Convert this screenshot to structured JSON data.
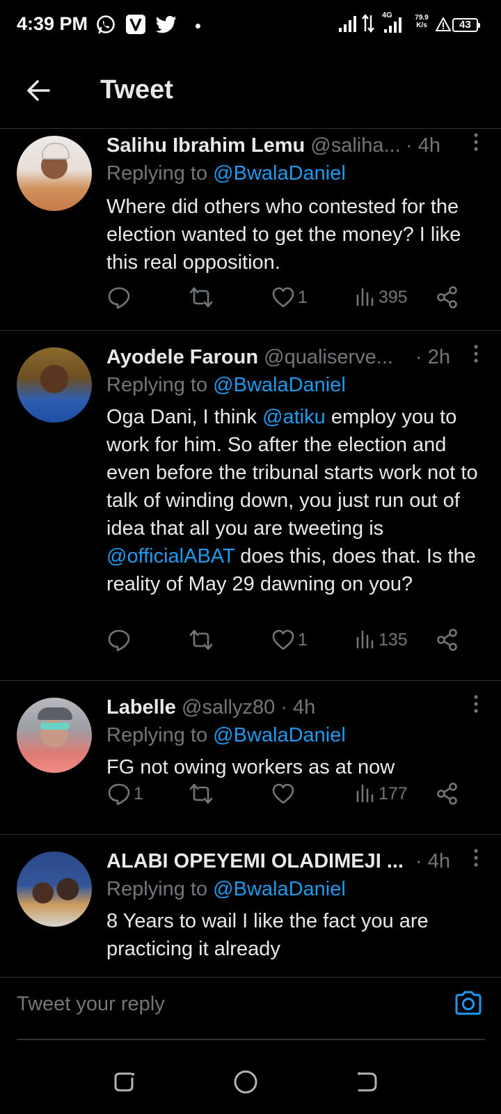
{
  "status_bar": {
    "time": "4:39 PM",
    "app_icons": [
      "whatsapp-icon",
      "vpn-v-icon",
      "twitter-icon"
    ],
    "network": "4G",
    "speed_value": "79.9",
    "speed_unit": "K/s",
    "battery": "43"
  },
  "header": {
    "title": "Tweet",
    "back_icon": "arrow-left-icon"
  },
  "replies": [
    {
      "name": "Salihu Ibrahim Lemu",
      "handle": "@saliha...",
      "time": "· 4h",
      "replying_prefix": "Replying to ",
      "replying_to": "@BwalaDaniel",
      "text": "Where did others who contested for the election wanted to get the money? I like this real opposition.",
      "stats": {
        "replies": "",
        "retweets": "",
        "likes": "1",
        "views": "395"
      }
    },
    {
      "name": "Ayodele Faroun",
      "handle": "@qualiserve...",
      "time": "· 2h",
      "replying_prefix": "Replying to ",
      "replying_to": "@BwalaDaniel",
      "text_parts": [
        "Oga Dani, I think ",
        "@atiku",
        " employ you to work for him. So after the election and even before the tribunal starts work not to talk of winding down, you just run out of idea that all you are tweeting is ",
        "@officialABAT",
        " does this, does that. Is the reality of May 29 dawning on you?"
      ],
      "stats": {
        "replies": "",
        "retweets": "",
        "likes": "1",
        "views": "135"
      }
    },
    {
      "name": "Labelle",
      "handle": "@sallyz80",
      "time": "· 4h",
      "replying_prefix": "Replying to ",
      "replying_to": "@BwalaDaniel",
      "text": "FG not owing workers as at now",
      "stats": {
        "replies": "1",
        "retweets": "",
        "likes": "",
        "views": "177"
      }
    },
    {
      "name": "ALABI OPEYEMI OLADIMEJI ...",
      "handle": "",
      "time": "· 4h",
      "replying_prefix": "Replying to ",
      "replying_to": "@BwalaDaniel",
      "text": "8 Years to wail I like the fact you are practicing it already"
    }
  ],
  "composer": {
    "placeholder": "Tweet your reply",
    "camera_icon": "camera-icon"
  },
  "colors": {
    "background": "#000000",
    "text": "#e7e9ea",
    "secondary": "#71767b",
    "accent": "#1d9bf0",
    "divider": "#2f3336"
  },
  "navbar": {
    "icons": [
      "recent-apps-icon",
      "home-circle-icon",
      "back-nav-icon"
    ]
  }
}
